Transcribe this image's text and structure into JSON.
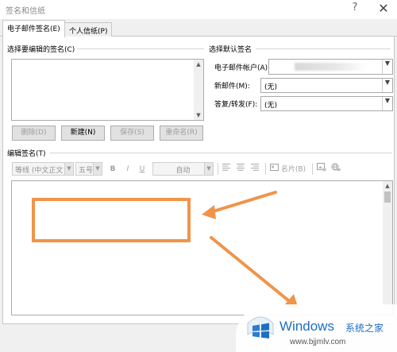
{
  "window": {
    "title": "签名和信纸",
    "help": "?",
    "close": "✕"
  },
  "tabs": [
    {
      "label": "电子邮件签名(E)",
      "active": true
    },
    {
      "label": "个人信纸(P)",
      "active": false
    }
  ],
  "select_signature": {
    "label": "选择要编辑的签名(C)"
  },
  "buttons": {
    "delete": "删除(D)",
    "new": "新建(N)",
    "save": "保存(S)",
    "rename": "重命名(R)"
  },
  "defaults": {
    "label": "选择默认签名",
    "account_label": "电子邮件帐户(A):",
    "new_messages_label": "新邮件(M):",
    "new_messages_value": "(无)",
    "replies_label": "答复/转发(F):",
    "replies_value": "(无)"
  },
  "edit": {
    "label": "编辑签名(T)",
    "font": "等线 (中文正文",
    "size": "五号",
    "bold": "B",
    "italic": "I",
    "underline": "U",
    "color": "自动",
    "business_card": "名片(B)"
  },
  "watermark": {
    "brand": "Windows",
    "suffix": "系统之家",
    "url": "www.bjjmlv.com"
  },
  "colors": {
    "annotation": "#f0944a",
    "windows_blue": "#1c6fc5"
  }
}
